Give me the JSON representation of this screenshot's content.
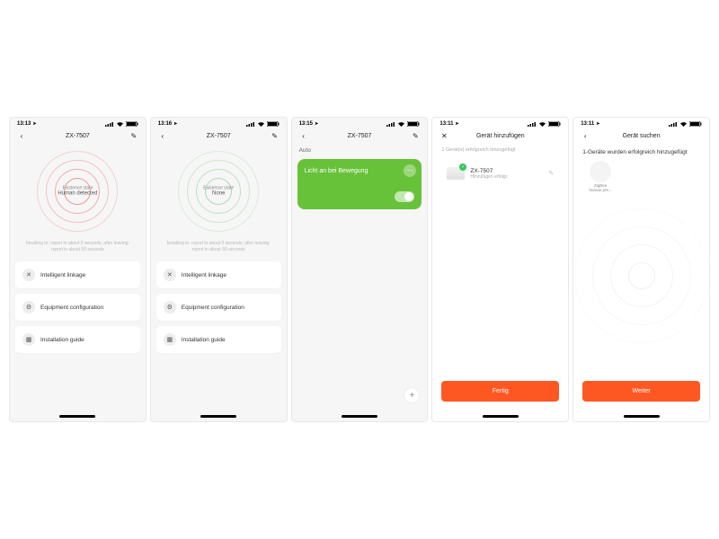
{
  "colors": {
    "accent": "#ff5722",
    "green": "#67c23a"
  },
  "statusbar": {
    "times": [
      "13:13",
      "13:16",
      "13:15",
      "13:11",
      "13:11"
    ]
  },
  "deviceTitle": "ZX-7507",
  "sensor": {
    "stateLabel": "Existence state",
    "state_detected": "Human detected",
    "state_none": "None",
    "note": "breaking in: report in about 0 seconds; after leaving: report in about 50 seconds"
  },
  "menu": {
    "linkage": "Intelligent linkage",
    "config": "Equipment configuration",
    "guide": "Installation guide"
  },
  "automation": {
    "section": "Auto",
    "cardTitle": "Licht an bei Bewegung"
  },
  "addDevice": {
    "title": "Gerät hinzufügen",
    "helper": "1 Gerät(e) erfolgreich hinzugefügt",
    "deviceName": "ZX-7507",
    "deviceStatus": "Hinzufügen erfolgr.",
    "done": "Fertig"
  },
  "searchDevice": {
    "title": "Gerät suchen",
    "found": "1-Geräte wurden erfolgreich hinzugefügt",
    "chipLine1": "ZigBee",
    "chipLine2": "human pre...",
    "next": "Weiter"
  }
}
